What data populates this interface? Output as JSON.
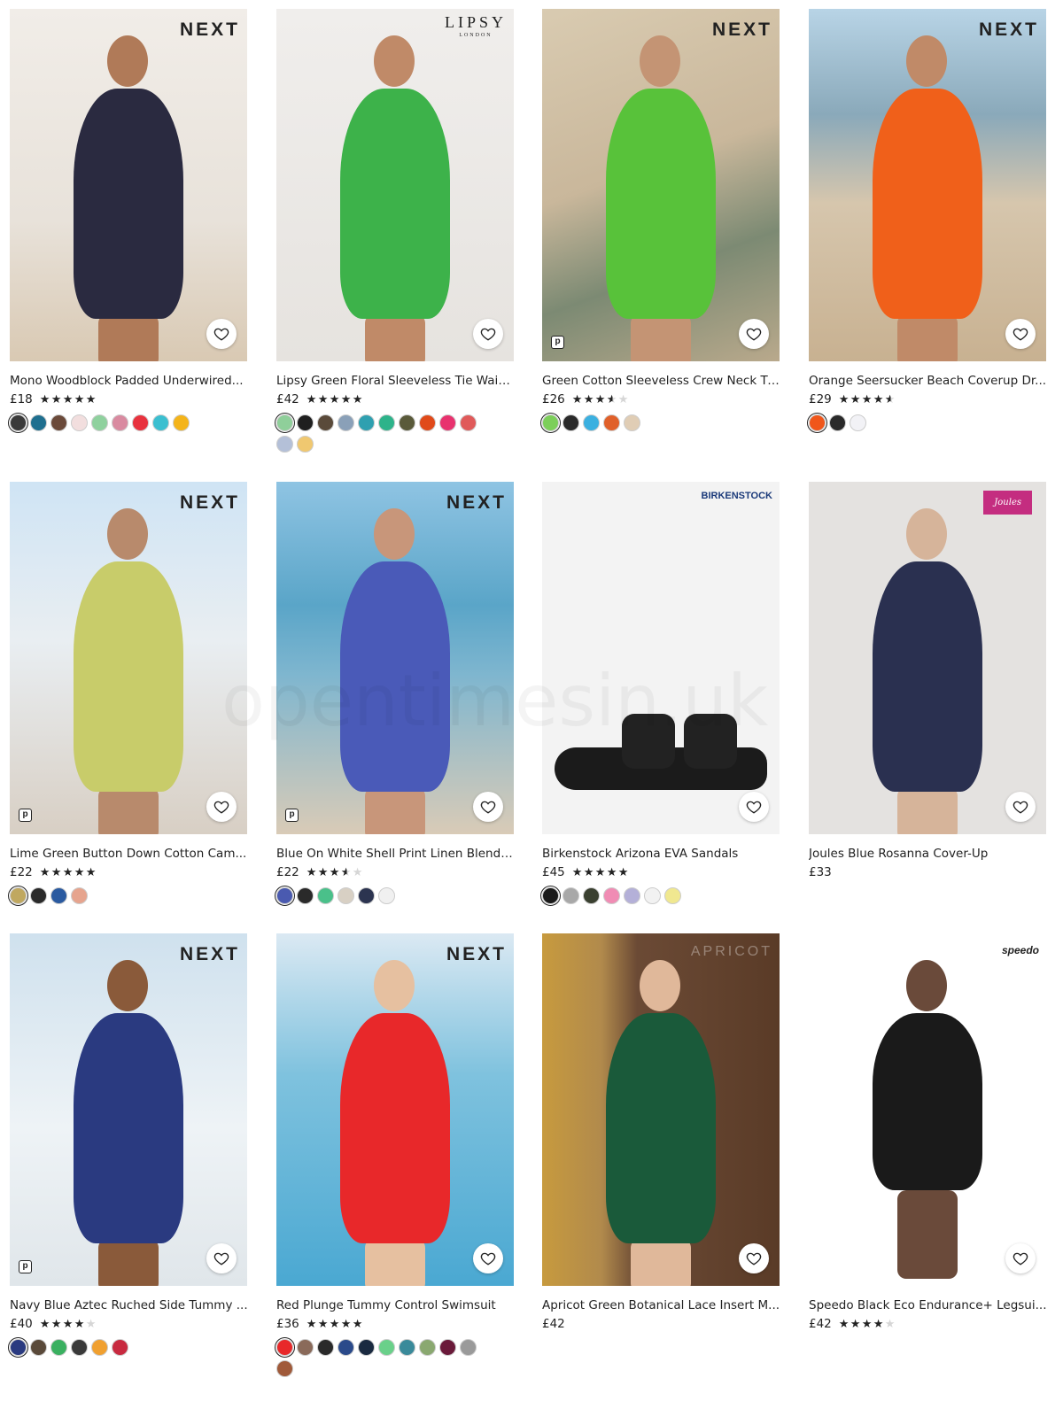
{
  "watermark": "opentimesin.uk",
  "products": [
    {
      "brand": "NEXT",
      "title": "Mono Woodblock Padded Underwired...",
      "price": "£18",
      "rating": 5,
      "badge": false,
      "swatches": [
        "#3a3a3a",
        "#1f6f8f",
        "#6b4a3a",
        "#f2dede",
        "#8fd19e",
        "#d98aa0",
        "#e8323e",
        "#3bbfd0",
        "#f4b41a"
      ]
    },
    {
      "brand": "LIPSY",
      "brand_sub": "LONDON",
      "title": "Lipsy Green Floral Sleeveless Tie Wais...",
      "price": "£42",
      "rating": 5,
      "badge": false,
      "swatches": [
        "#8fcf9a",
        "#1f1f1f",
        "#5a4a3a",
        "#8aa0b8",
        "#2fa0b0",
        "#2db38a",
        "#5a5a3a",
        "#e04a1a",
        "#e8326e",
        "#e05a5a",
        "#b4c0d8",
        "#f0c870"
      ]
    },
    {
      "brand": "NEXT",
      "title": "Green Cotton Sleeveless Crew Neck Ti...",
      "price": "£26",
      "rating": 3.5,
      "badge": true,
      "swatches": [
        "#7ccf5a",
        "#2a2a2a",
        "#3bb0e0",
        "#e0602a",
        "#e0cdb5"
      ]
    },
    {
      "brand": "NEXT",
      "title": "Orange Seersucker Beach Coverup Dr...",
      "price": "£29",
      "rating": 4.5,
      "badge": false,
      "swatches": [
        "#f0561a",
        "#2a2a2a",
        "#f2f2f6"
      ]
    },
    {
      "brand": "NEXT",
      "title": "Lime Green Button Down Cotton Cam...",
      "price": "£22",
      "rating": 5,
      "badge": true,
      "swatches": [
        "#c0a860",
        "#2a2a2a",
        "#2a5aa0",
        "#e6a48e"
      ]
    },
    {
      "brand": "NEXT",
      "title": "Blue On White Shell Print Linen Blend R...",
      "price": "£22",
      "rating": 3.5,
      "badge": true,
      "swatches": [
        "#4a5ab0",
        "#2a2a2a",
        "#4ac08a",
        "#d8d0c4",
        "#2c3450",
        "#f0f0f0"
      ]
    },
    {
      "brand": "BIRKENSTOCK",
      "title": "Birkenstock Arizona EVA Sandals",
      "price": "£45",
      "rating": 5,
      "badge": false,
      "swatches": [
        "#1a1a1a",
        "#a8a8a8",
        "#3a4030",
        "#f08cb4",
        "#b4b0d8",
        "#f2f2f2",
        "#f0e890"
      ]
    },
    {
      "brand": "Joules",
      "title": "Joules Blue Rosanna Cover-Up",
      "price": "£33",
      "rating": 0,
      "badge": false,
      "swatches": []
    },
    {
      "brand": "NEXT",
      "title": "Navy Blue Aztec Ruched Side Tummy ...",
      "price": "£40",
      "rating": 4,
      "badge": true,
      "swatches": [
        "#2a3a80",
        "#5a4a3a",
        "#3ab060",
        "#3a3a3a",
        "#f0a030",
        "#c82a40"
      ]
    },
    {
      "brand": "NEXT",
      "title": "Red Plunge Tummy Control Swimsuit",
      "price": "£36",
      "rating": 5,
      "badge": false,
      "swatches": [
        "#e8282a",
        "#8a6a5a",
        "#2a2a2a",
        "#2a4a8a",
        "#1a2a40",
        "#6ad08a",
        "#3a8a9a",
        "#8aa870",
        "#6a1a3a",
        "#9a9a9a",
        "#a05a3a"
      ]
    },
    {
      "brand": "APRICOT",
      "title": "Apricot Green Botanical Lace Insert M...",
      "price": "£42",
      "rating": 0,
      "badge": false,
      "swatches": []
    },
    {
      "brand": "speedo",
      "title": "Speedo Black Eco Endurance+ Legsui...",
      "price": "£42",
      "rating": 4,
      "badge": false,
      "swatches": []
    }
  ]
}
